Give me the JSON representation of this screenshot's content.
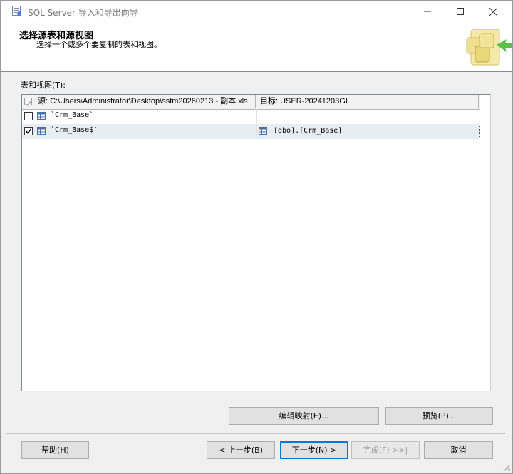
{
  "window": {
    "title": "SQL Server 导入和导出向导"
  },
  "header": {
    "title": "选择源表和源视图",
    "subtitle": "选择一个或多个要复制的表和视图。"
  },
  "list_label": "表和视图(T):",
  "grid": {
    "columns": {
      "source": "源: C:\\Users\\Administrator\\Desktop\\sstm20260213 - 副本.xls",
      "destination": "目标: USER-20241203GI"
    },
    "rows": [
      {
        "checked": false,
        "source": "`Crm_Base`",
        "destination": ""
      },
      {
        "checked": true,
        "source": "`Crm_Base$`",
        "destination": "[dbo].[Crm_Base]"
      }
    ]
  },
  "buttons": {
    "edit_mappings": "编辑映射(E)...",
    "preview": "预览(P)...",
    "help": "帮助(H)",
    "back": "< 上一步(B)",
    "next": "下一步(N) >",
    "finish": "完成(F) >>|",
    "cancel": "取消"
  },
  "icons": {
    "app": "sql-wizard-icon",
    "minimize": "minimize-icon",
    "maximize": "maximize-icon",
    "close": "close-icon",
    "table": "table-icon"
  }
}
